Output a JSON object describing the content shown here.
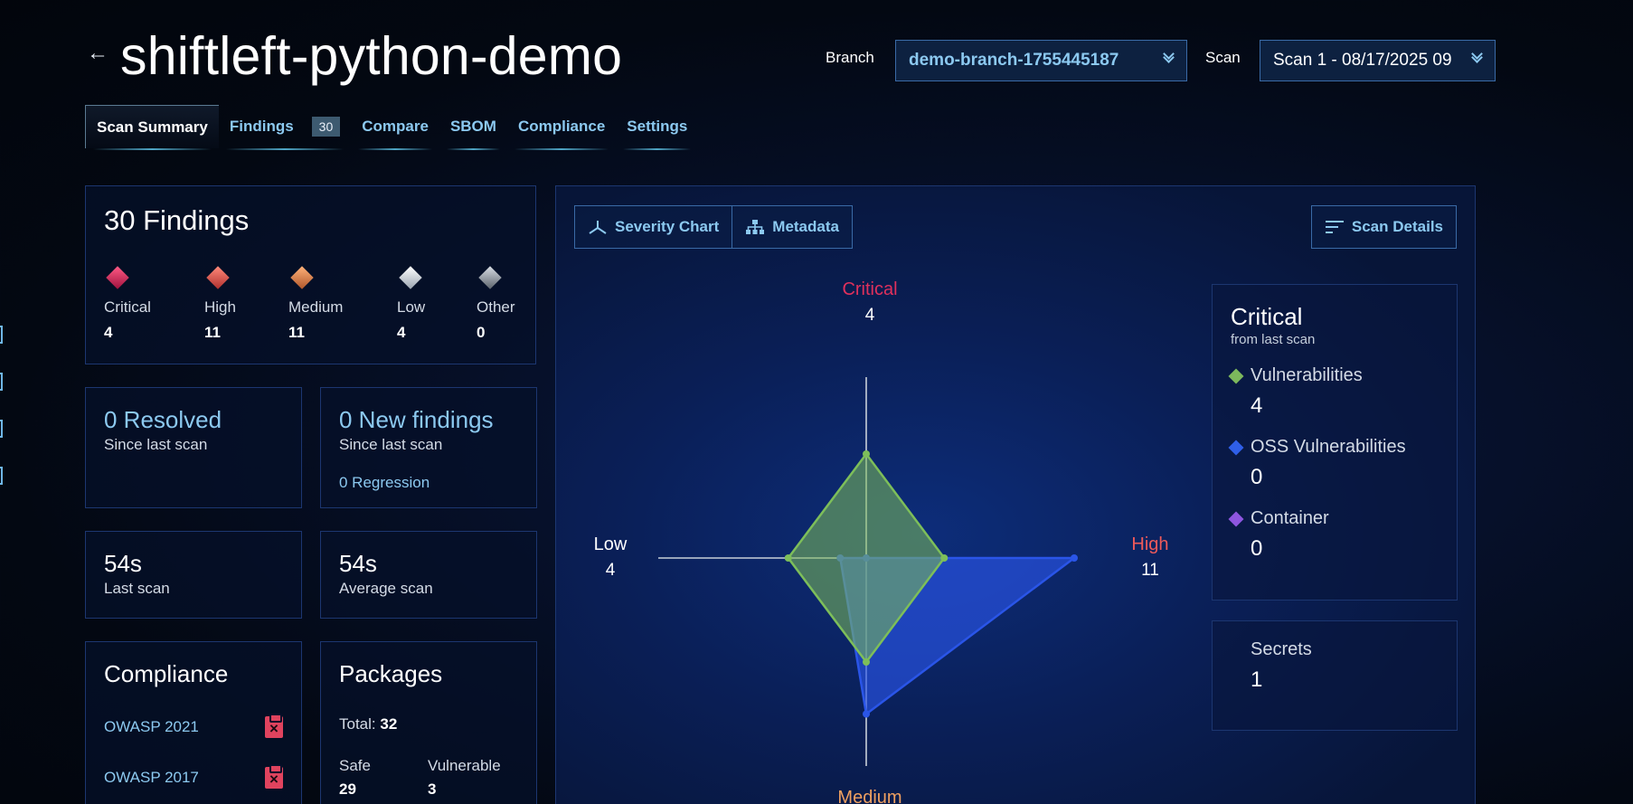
{
  "header": {
    "title": "shiftleft-python-demo",
    "branch_label": "Branch",
    "branch_value": "demo-branch-1755445187",
    "scan_label": "Scan",
    "scan_value": "Scan 1 - 08/17/2025 09"
  },
  "tabs": [
    {
      "label": "Scan Summary",
      "active": true
    },
    {
      "label": "Findings",
      "badge": "30"
    },
    {
      "label": "Compare"
    },
    {
      "label": "SBOM"
    },
    {
      "label": "Compliance"
    },
    {
      "label": "Settings"
    }
  ],
  "findings": {
    "title": "30 Findings",
    "severities": [
      {
        "label": "Critical",
        "value": "4",
        "color": "#e0305c"
      },
      {
        "label": "High",
        "value": "11",
        "color": "#ef5a5a"
      },
      {
        "label": "Medium",
        "value": "11",
        "color": "#e98a4a"
      },
      {
        "label": "Low",
        "value": "4",
        "color": "#e6e9ef"
      },
      {
        "label": "Other",
        "value": "0",
        "color": "#9aa0a8"
      }
    ]
  },
  "resolved": {
    "title": "0 Resolved",
    "sub": "Since last scan"
  },
  "new_findings": {
    "title": "0 New findings",
    "sub": "Since last scan",
    "regression": "0 Regression"
  },
  "last_scan": {
    "value": "54s",
    "label": "Last scan"
  },
  "avg_scan": {
    "value": "54s",
    "label": "Average scan"
  },
  "compliance": {
    "title": "Compliance",
    "items": [
      "OWASP 2021",
      "OWASP 2017"
    ]
  },
  "packages": {
    "title": "Packages",
    "total_label": "Total:",
    "total_value": "32",
    "safe_label": "Safe",
    "safe_value": "29",
    "vuln_label": "Vulnerable",
    "vuln_value": "3"
  },
  "chart_panel": {
    "severity_chart_label": "Severity Chart",
    "metadata_label": "Metadata",
    "scan_details_label": "Scan Details",
    "icons": [
      "radar-chart-icon",
      "hierarchy-icon",
      "filter-lines-icon"
    ]
  },
  "chart_data": {
    "type": "radar",
    "axes": [
      {
        "label": "Critical",
        "value": "4",
        "color": "#e0305c"
      },
      {
        "label": "High",
        "value": "11",
        "color": "#ef5a5a"
      },
      {
        "label": "Medium",
        "value": "",
        "color": "#f0a060"
      },
      {
        "label": "Low",
        "value": "4",
        "color": "#ffffff"
      }
    ],
    "series": [
      {
        "name": "Vulnerabilities",
        "values": [
          4,
          3,
          4,
          3
        ],
        "color": "#7dbe5a"
      },
      {
        "name": "OSS Vulnerabilities",
        "values": [
          0,
          8,
          6,
          1
        ],
        "color": "#2a55e8"
      }
    ],
    "max": 8
  },
  "legend": {
    "title": "Critical",
    "sub": "from last scan",
    "items": [
      {
        "name": "Vulnerabilities",
        "value": "4",
        "color": "#7db85c"
      },
      {
        "name": "OSS Vulnerabilities",
        "value": "0",
        "color": "#2f5fe8"
      },
      {
        "name": "Container",
        "value": "0",
        "color": "#8e56e0"
      }
    ]
  },
  "secrets": {
    "label": "Secrets",
    "value": "1"
  }
}
